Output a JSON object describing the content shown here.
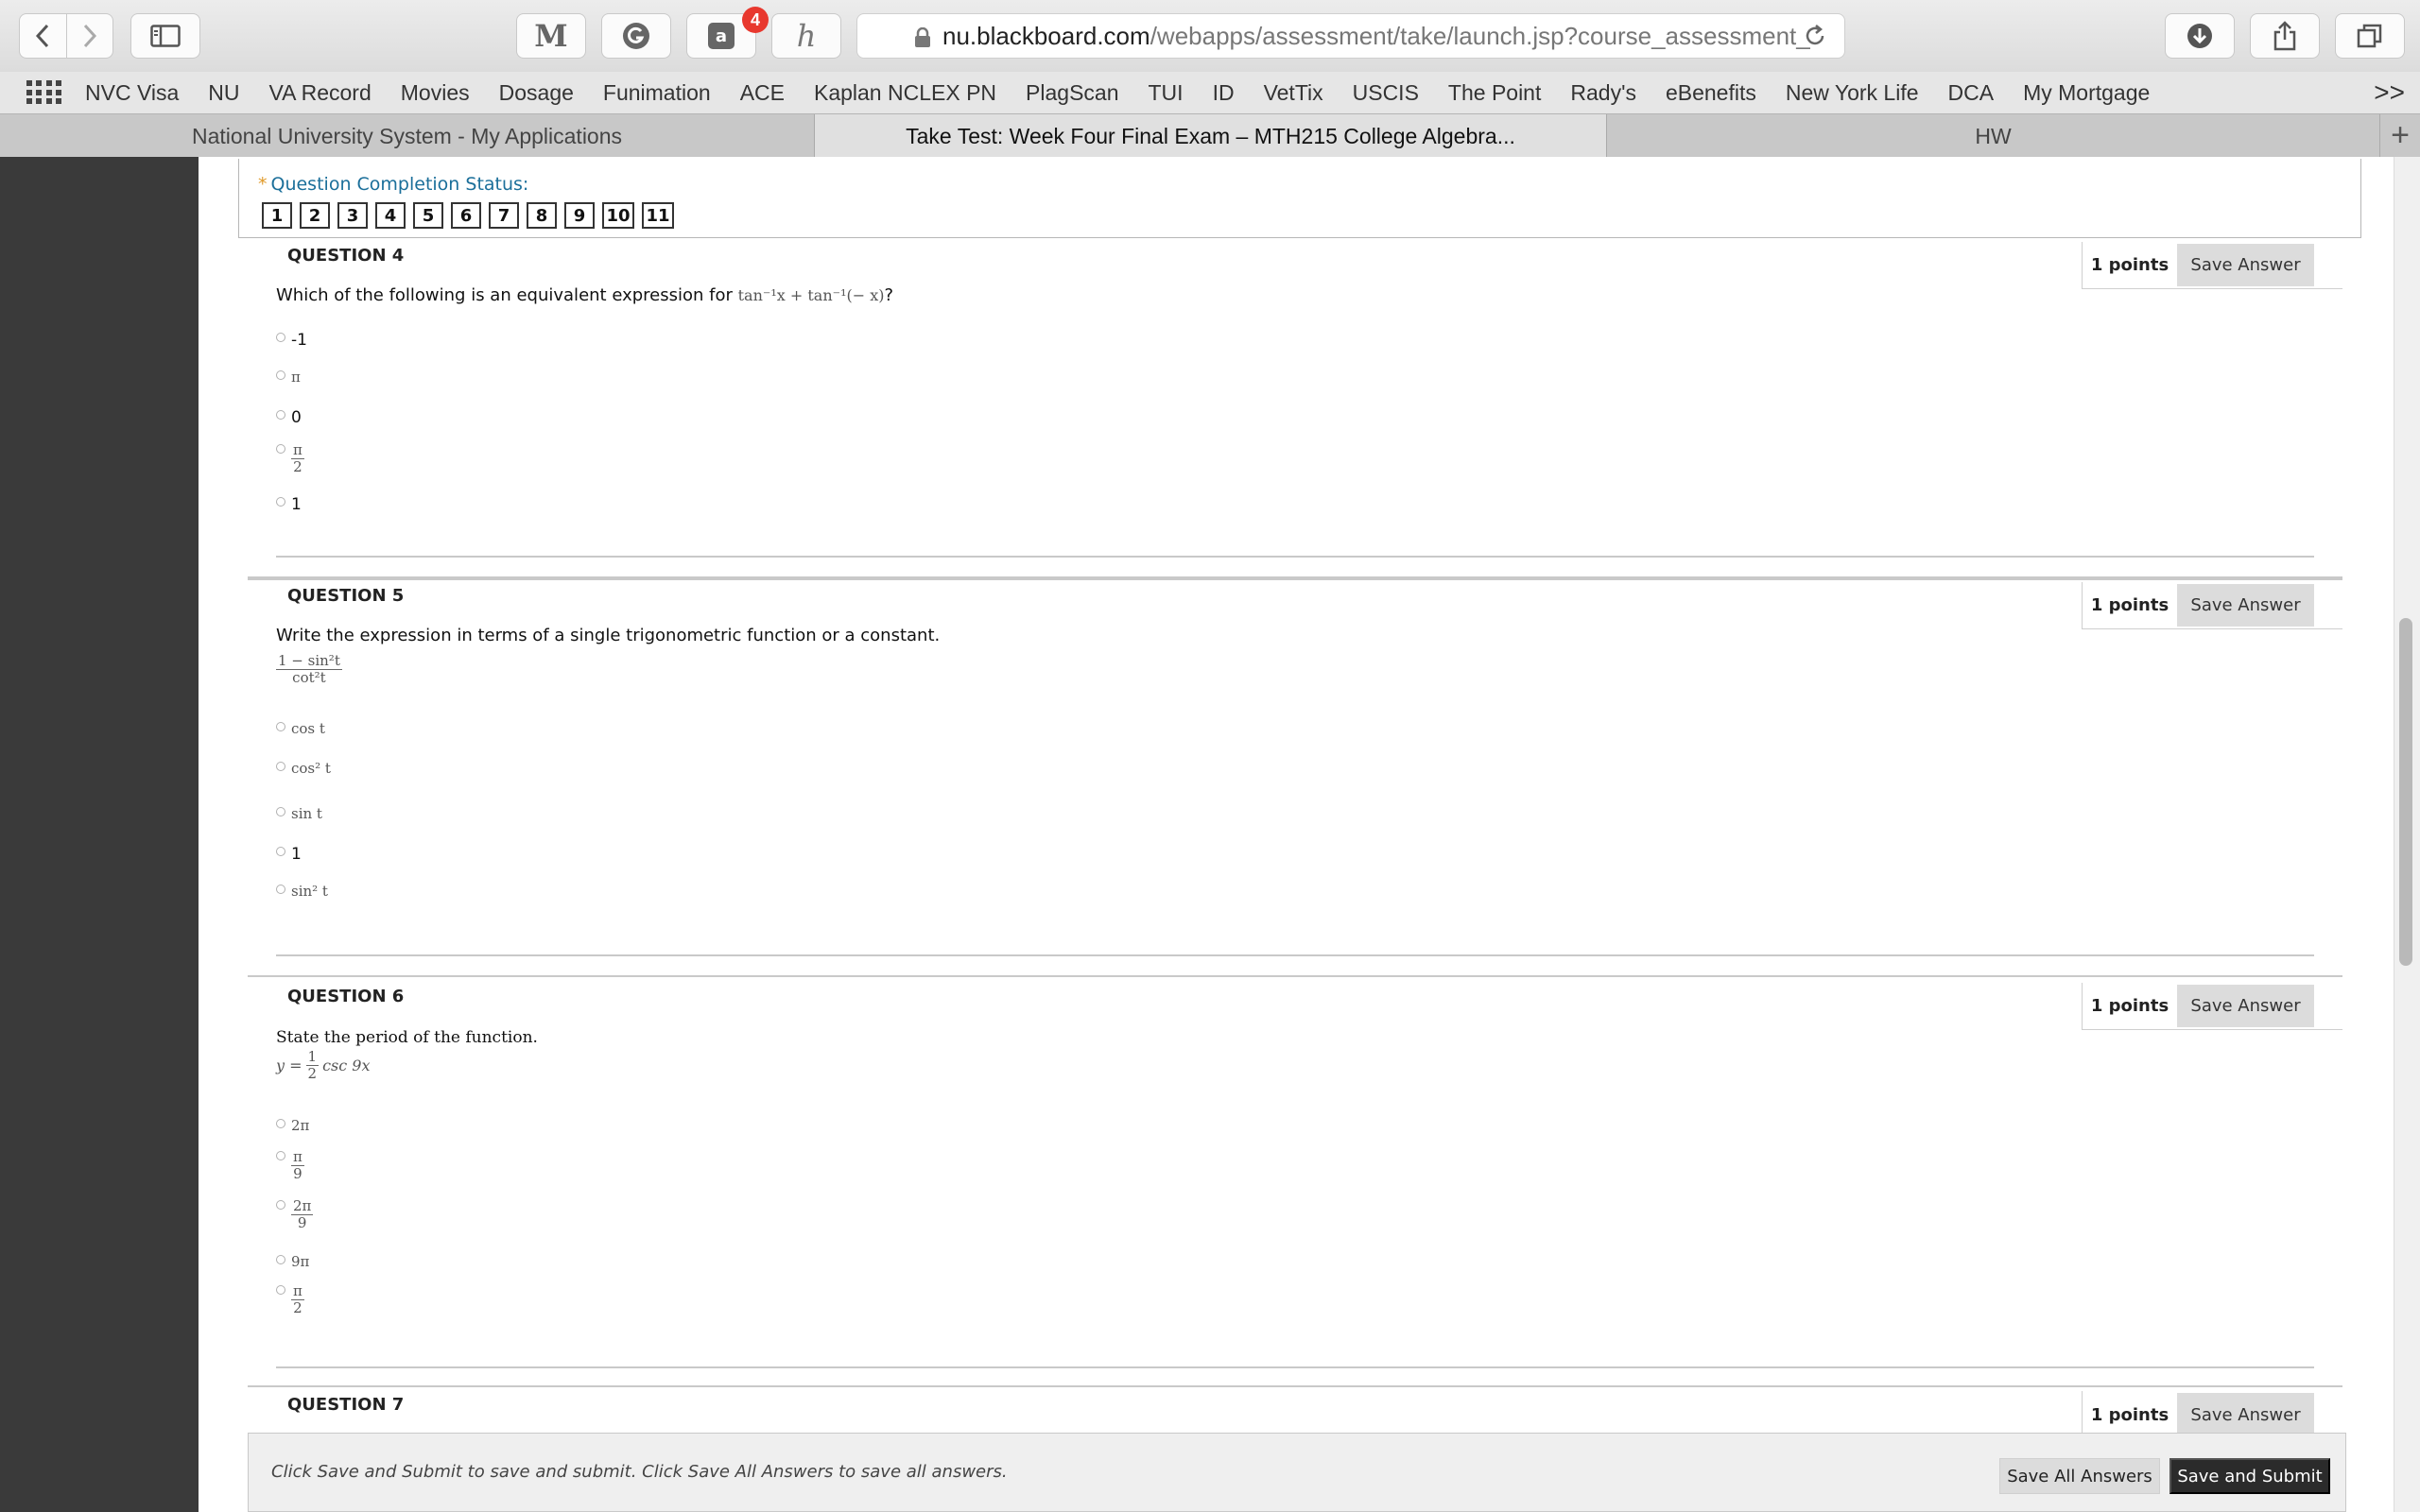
{
  "browser": {
    "url_domain": "nu.blackboard.com",
    "url_path": "/webapps/assessment/take/launch.jsp?course_assessment_",
    "extension_badge": "4",
    "icons": [
      "back-icon",
      "forward-icon",
      "sidebar-icon",
      "mendeley-icon",
      "grammarly-icon",
      "amazon-icon",
      "honey-icon",
      "lock-icon",
      "reload-icon",
      "download-icon",
      "share-icon",
      "tabs-overview-icon"
    ]
  },
  "bookmarks": [
    "NVC Visa",
    "NU",
    "VA Record",
    "Movies",
    "Dosage",
    "Funimation",
    "ACE",
    "Kaplan NCLEX PN",
    "PlagScan",
    "TUI",
    "ID",
    "VetTix",
    "USCIS",
    "The Point",
    "Rady's",
    "eBenefits",
    "New York Life",
    "DCA",
    "My Mortgage"
  ],
  "bookmarks_more": ">>",
  "tabs": [
    {
      "label": "National University System - My Applications"
    },
    {
      "label": "Take Test: Week Four Final Exam – MTH215 College Algebra..."
    },
    {
      "label": "HW"
    }
  ],
  "status": {
    "star": "*",
    "title": "Question Completion Status:",
    "numbers": [
      "1",
      "2",
      "3",
      "4",
      "5",
      "6",
      "7",
      "8",
      "9",
      "10",
      "11"
    ]
  },
  "questions": [
    {
      "title": "QUESTION 4",
      "points": "1 points",
      "save": "Save Answer",
      "text": "Which of the following is an equivalent expression for",
      "expr": "tan⁻¹x + tan⁻¹(− x)",
      "expr_tail": "?",
      "options": [
        "-1",
        "π",
        "0",
        "π/2",
        "1"
      ]
    },
    {
      "title": "QUESTION 5",
      "points": "1 points",
      "save": "Save Answer",
      "text": "Write the expression in terms of a single trigonometric function or a constant.",
      "expr_num": "1 − sin²t",
      "expr_den": "cot²t",
      "options": [
        "cos t",
        "cos² t",
        "sin t",
        "1",
        "sin² t"
      ]
    },
    {
      "title": "QUESTION 6",
      "points": "1 points",
      "save": "Save Answer",
      "text": "State the period of the function.",
      "expr_prefix": "y =",
      "expr_num": "1",
      "expr_den": "2",
      "expr_suffix": "csc 9x",
      "options": [
        "2π",
        "π/9",
        "2π/9",
        "9π",
        "π/2"
      ]
    },
    {
      "title": "QUESTION 7",
      "points": "1 points",
      "save": "Save Answer"
    }
  ],
  "footer": {
    "note": "Click Save and Submit to save and submit. Click Save All Answers to save all answers.",
    "save_all": "Save All Answers",
    "submit": "Save and Submit"
  }
}
